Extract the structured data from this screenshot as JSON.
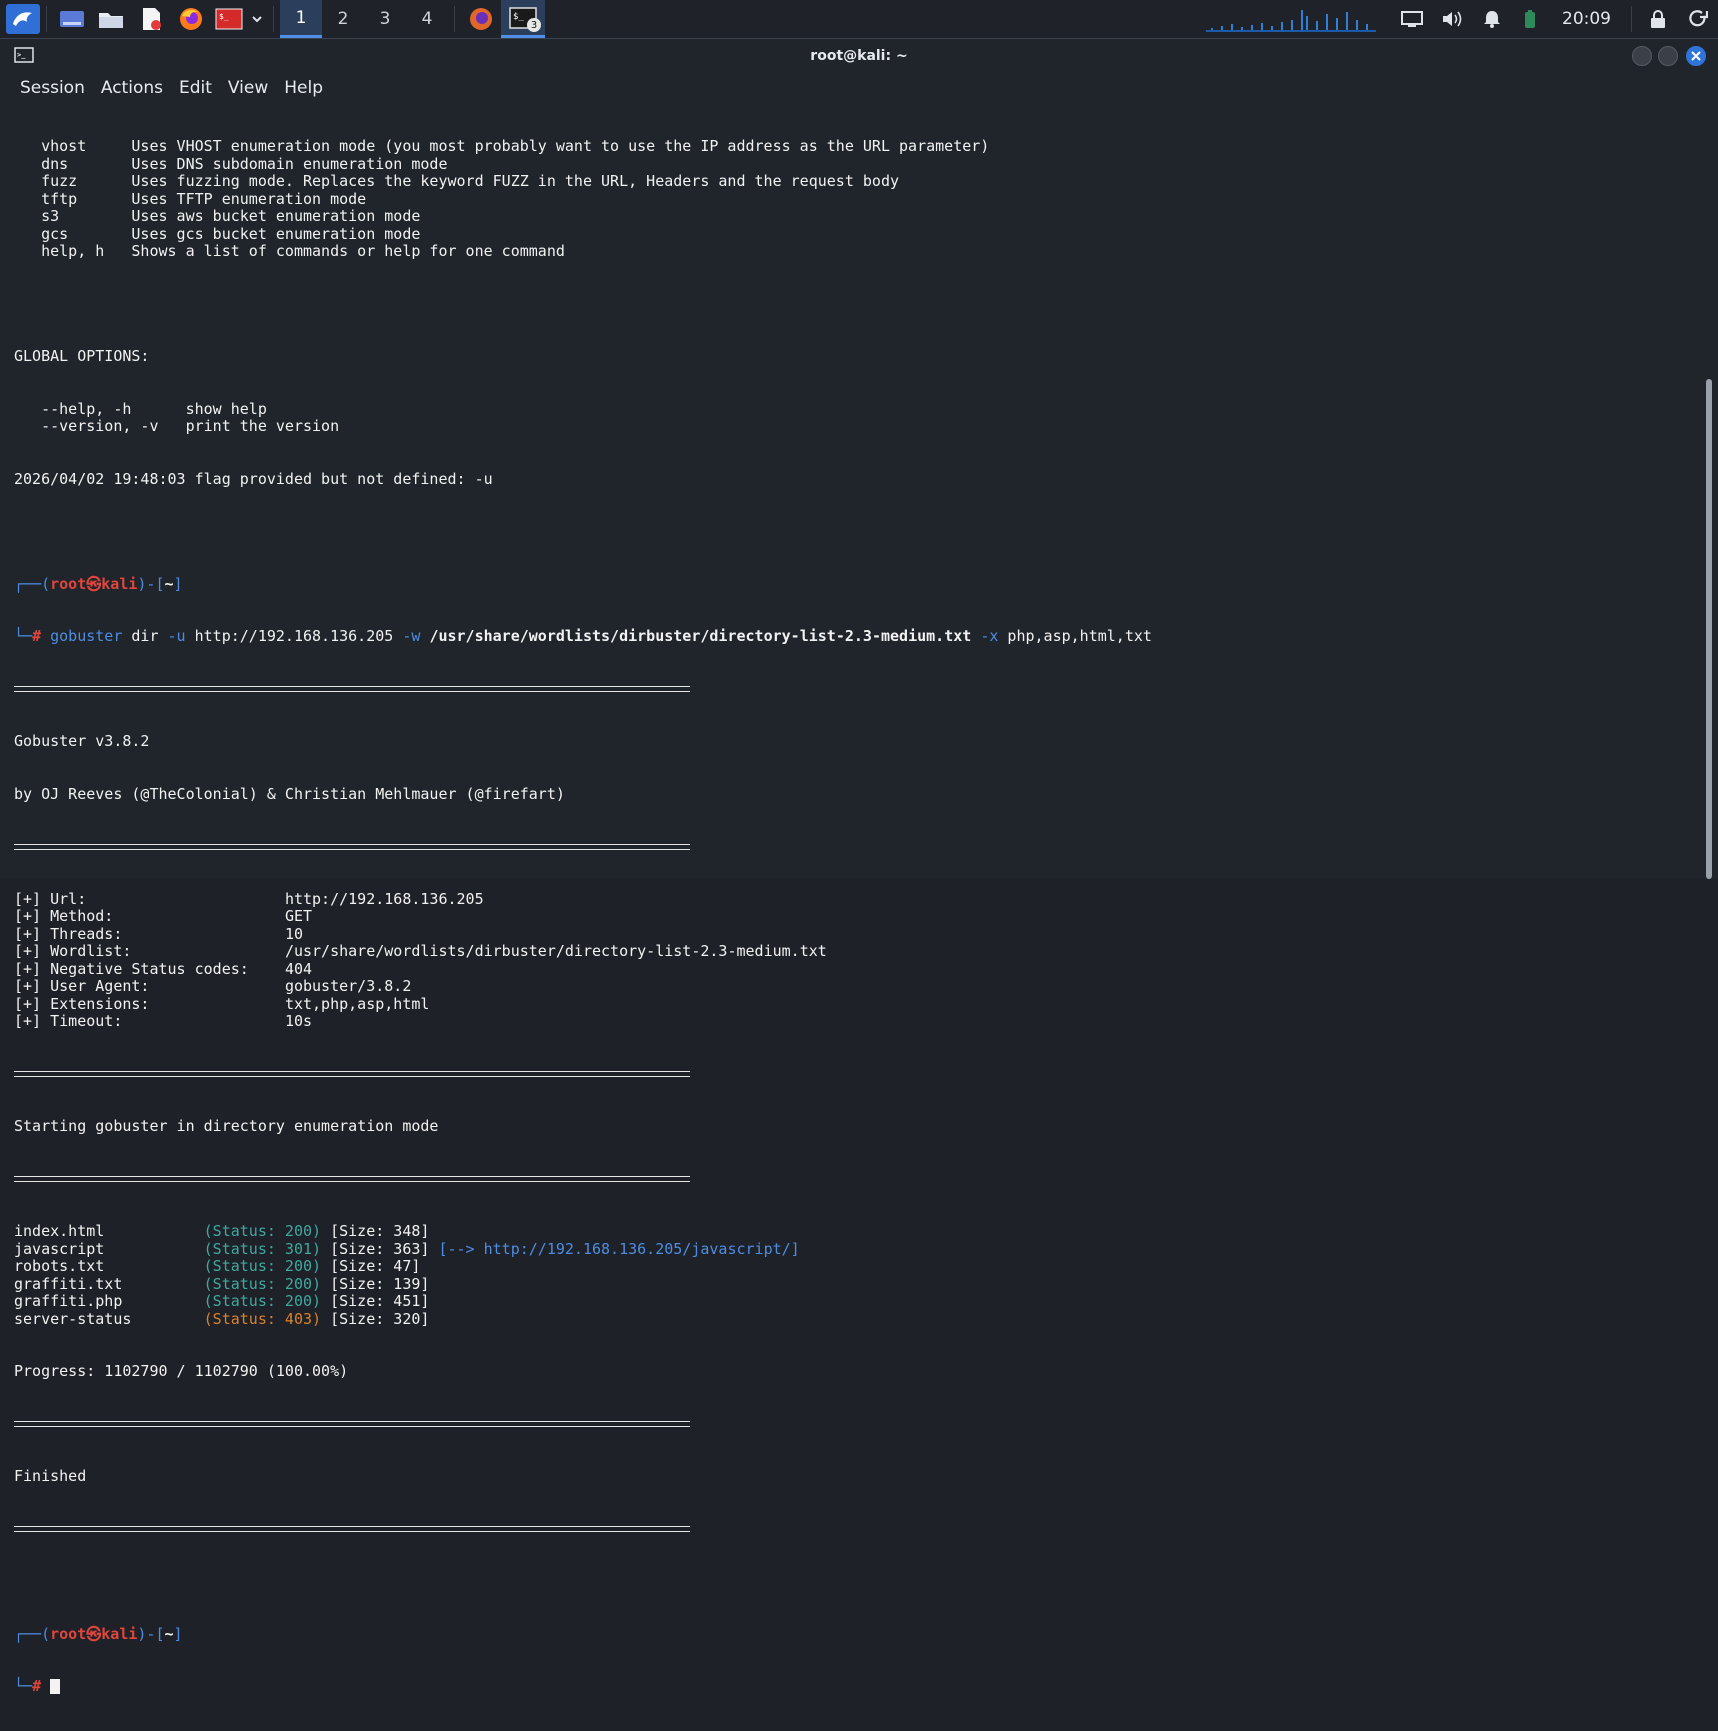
{
  "panel": {
    "workspaces": [
      "1",
      "2",
      "3",
      "4"
    ],
    "active_workspace": "1",
    "terminal_badge": "3",
    "clock": "20:09"
  },
  "window": {
    "title": "root@kali: ~",
    "menu": [
      "Session",
      "Actions",
      "Edit",
      "View",
      "Help"
    ]
  },
  "terminal": {
    "modes": [
      {
        "cmd": "vhost",
        "desc": "Uses VHOST enumeration mode (you most probably want to use the IP address as the URL parameter)"
      },
      {
        "cmd": "dns",
        "desc": "Uses DNS subdomain enumeration mode"
      },
      {
        "cmd": "fuzz",
        "desc": "Uses fuzzing mode. Replaces the keyword FUZZ in the URL, Headers and the request body"
      },
      {
        "cmd": "tftp",
        "desc": "Uses TFTP enumeration mode"
      },
      {
        "cmd": "s3",
        "desc": "Uses aws bucket enumeration mode"
      },
      {
        "cmd": "gcs",
        "desc": "Uses gcs bucket enumeration mode"
      },
      {
        "cmd": "help, h",
        "desc": "Shows a list of commands or help for one command"
      }
    ],
    "global_header": "GLOBAL OPTIONS:",
    "global_opts": [
      {
        "flag": "--help, -h",
        "desc": "show help"
      },
      {
        "flag": "--version, -v",
        "desc": "print the version"
      }
    ],
    "error_line": "2026/04/02 19:48:03 flag provided but not defined: -u",
    "prompt": {
      "user": "root",
      "at": "㉿",
      "host": "kali",
      "dir": "~"
    },
    "command": {
      "bin": "gobuster",
      "sub": "dir",
      "flag_u": "-u",
      "url": "http://192.168.136.205",
      "flag_w": "-w",
      "wordlist": "/usr/share/wordlists/dirbuster/directory-list-2.3-medium.txt",
      "flag_x": "-x",
      "ext": "php,asp,html,txt"
    },
    "banner": [
      "Gobuster v3.8.2",
      "by OJ Reeves (@TheColonial) & Christian Mehlmauer (@firefart)"
    ],
    "config": [
      {
        "key": "[+] Url:",
        "val": "http://192.168.136.205"
      },
      {
        "key": "[+] Method:",
        "val": "GET"
      },
      {
        "key": "[+] Threads:",
        "val": "10"
      },
      {
        "key": "[+] Wordlist:",
        "val": "/usr/share/wordlists/dirbuster/directory-list-2.3-medium.txt"
      },
      {
        "key": "[+] Negative Status codes:",
        "val": "404"
      },
      {
        "key": "[+] User Agent:",
        "val": "gobuster/3.8.2"
      },
      {
        "key": "[+] Extensions:",
        "val": "txt,php,asp,html"
      },
      {
        "key": "[+] Timeout:",
        "val": "10s"
      }
    ],
    "starting": "Starting gobuster in directory enumeration mode",
    "results": [
      {
        "path": "index.html",
        "status": "(Status: 200)",
        "size": "[Size: 348]",
        "redirect": ""
      },
      {
        "path": "javascript",
        "status": "(Status: 301)",
        "size": "[Size: 363]",
        "redirect": "[--> http://192.168.136.205/javascript/]"
      },
      {
        "path": "robots.txt",
        "status": "(Status: 200)",
        "size": "[Size: 47]",
        "redirect": ""
      },
      {
        "path": "graffiti.txt",
        "status": "(Status: 200)",
        "size": "[Size: 139]",
        "redirect": ""
      },
      {
        "path": "graffiti.php",
        "status": "(Status: 200)",
        "size": "[Size: 451]",
        "redirect": ""
      },
      {
        "path": "server-status",
        "status": "(Status: 403)",
        "size": "[Size: 320]",
        "redirect": ""
      }
    ],
    "progress": "Progress: 1102790 / 1102790 (100.00%)",
    "finished": "Finished"
  }
}
